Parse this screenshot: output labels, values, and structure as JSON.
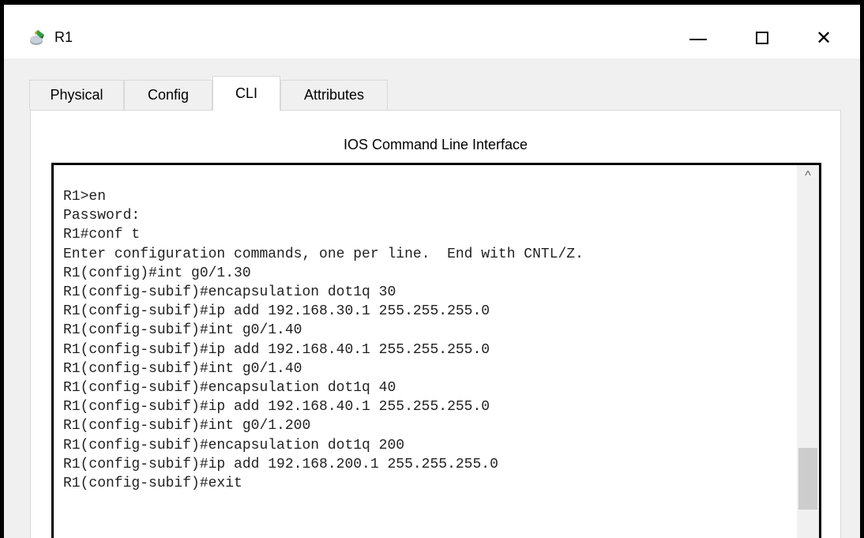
{
  "window": {
    "title": "R1",
    "controls": {
      "minimize": "minimize",
      "maximize": "maximize",
      "close": "close"
    },
    "close_glyph": "✕"
  },
  "tabs": [
    {
      "label": "Physical"
    },
    {
      "label": "Config"
    },
    {
      "label": "CLI",
      "active": true
    },
    {
      "label": "Attributes"
    }
  ],
  "panel": {
    "title": "IOS Command Line Interface"
  },
  "terminal": {
    "lines": [
      "R1>en",
      "Password:",
      "R1#conf t",
      "Enter configuration commands, one per line.  End with CNTL/Z.",
      "R1(config)#int g0/1.30",
      "R1(config-subif)#encapsulation dot1q 30",
      "R1(config-subif)#ip add 192.168.30.1 255.255.255.0",
      "R1(config-subif)#int g0/1.40",
      "R1(config-subif)#ip add 192.168.40.1 255.255.255.0",
      "R1(config-subif)#int g0/1.40",
      "R1(config-subif)#encapsulation dot1q 40",
      "R1(config-subif)#ip add 192.168.40.1 255.255.255.0",
      "R1(config-subif)#int g0/1.200",
      "R1(config-subif)#encapsulation dot1q 200",
      "R1(config-subif)#ip add 192.168.200.1 255.255.255.0",
      "R1(config-subif)#exit"
    ],
    "scroll_up_glyph": "^",
    "scroll_position": 0.85
  },
  "icons": {
    "app": "router-icon"
  }
}
